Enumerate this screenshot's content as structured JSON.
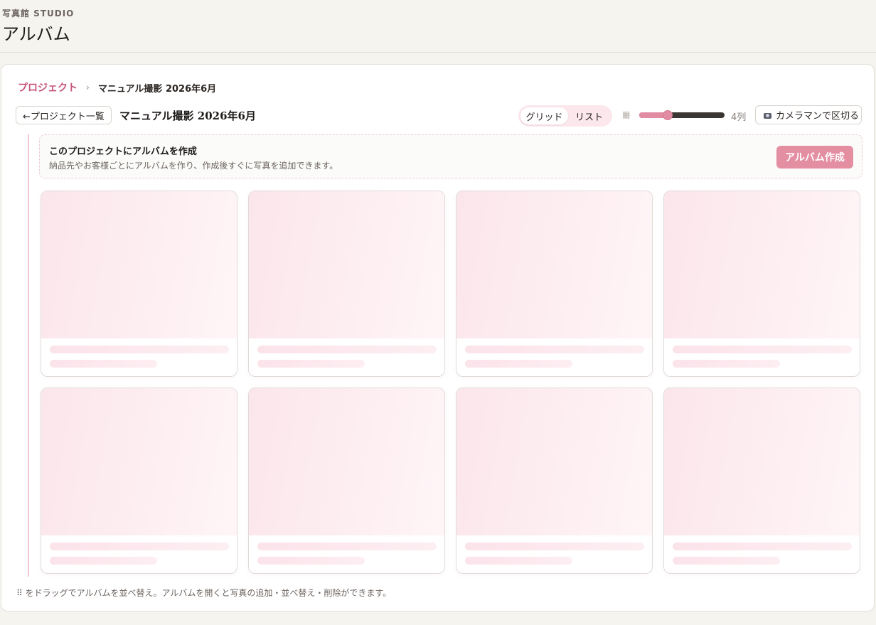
{
  "header": {
    "brand": "写真館 STUDIO",
    "title": "アルバム"
  },
  "breadcrumb": {
    "parent": "プロジェクト",
    "separator": "›",
    "current": "マニュアル撮影 2026年6月"
  },
  "toolbar": {
    "back_label": "←プロジェクト一覧",
    "project_name": "マニュアル撮影 2026年6月",
    "view_toggle": {
      "grid": "グリッド",
      "list": "リスト",
      "selected": "grid"
    },
    "density_icon": "grid-density-icon",
    "columns": {
      "value": 4,
      "min": 2,
      "max": 8,
      "label": "4列"
    },
    "split_button": {
      "icon": "camera-icon",
      "label": "カメラマンで区切る"
    }
  },
  "create_banner": {
    "title": "このプロジェクトにアルバムを作成",
    "description": "納品先やお客様ごとにアルバムを作り、作成後すぐに写真を追加できます。",
    "button_label": "アルバム作成"
  },
  "albums": {
    "loading": true,
    "placeholder_count": 8
  },
  "footer_hint": "⠿ をドラッグでアルバムを並べ替え。アルバムを開くと写真の追加・並べ替え・削除ができます。",
  "colors": {
    "accent": "#e48ea2",
    "link": "#c55378",
    "skeleton": "#fbe6eb",
    "background": "#f6f4ef"
  }
}
